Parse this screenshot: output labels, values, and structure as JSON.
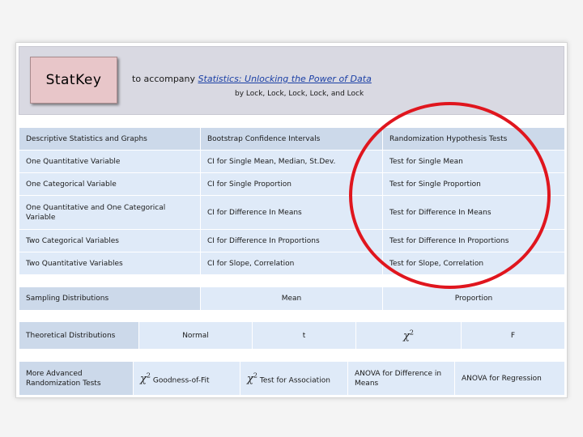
{
  "header": {
    "logo": "StatKey",
    "tagline_prefix": "to accompany ",
    "tagline_link": "Statistics: Unlocking the Power of Data",
    "authors": "by Lock, Lock, Lock, Lock, and Lock"
  },
  "main_table": {
    "headers": [
      "Descriptive Statistics and Graphs",
      "Bootstrap Confidence Intervals",
      "Randomization Hypothesis Tests"
    ],
    "rows": [
      [
        "One Quantitative Variable",
        "CI for Single Mean, Median, St.Dev.",
        "Test for Single Mean"
      ],
      [
        "One Categorical Variable",
        "CI for Single Proportion",
        "Test for Single Proportion"
      ],
      [
        "One Quantitative and One Categorical Variable",
        "CI for Difference In Means",
        "Test for Difference In Means"
      ],
      [
        "Two Categorical Variables",
        "CI for Difference In Proportions",
        "Test for Difference In Proportions"
      ],
      [
        "Two Quantitative Variables",
        "CI for Slope, Correlation",
        "Test for Slope, Correlation"
      ]
    ]
  },
  "sampling": {
    "label": "Sampling Distributions",
    "options": [
      "Mean",
      "Proportion"
    ]
  },
  "theoretical": {
    "label": "Theoretical Distributions",
    "normal": "Normal",
    "t": "t",
    "chi_symbol": "χ",
    "chi_sup": "2",
    "f": "F"
  },
  "advanced": {
    "label": "More Advanced Randomization Tests",
    "chi_symbol": "χ",
    "chi_sup": "2",
    "gof": "Goodness-of-Fit",
    "assoc": "Test for Association",
    "anova_means": "ANOVA for Difference in Means",
    "anova_reg": "ANOVA for Regression"
  },
  "colors": {
    "header_bg": "#d9d9e2",
    "logo_bg": "#e8c6c9",
    "cell_bg": "#dfeaf8",
    "header_cell_bg": "#ccd9ea",
    "link": "#1a3fa5",
    "annotation_circle": "#e0161e"
  }
}
